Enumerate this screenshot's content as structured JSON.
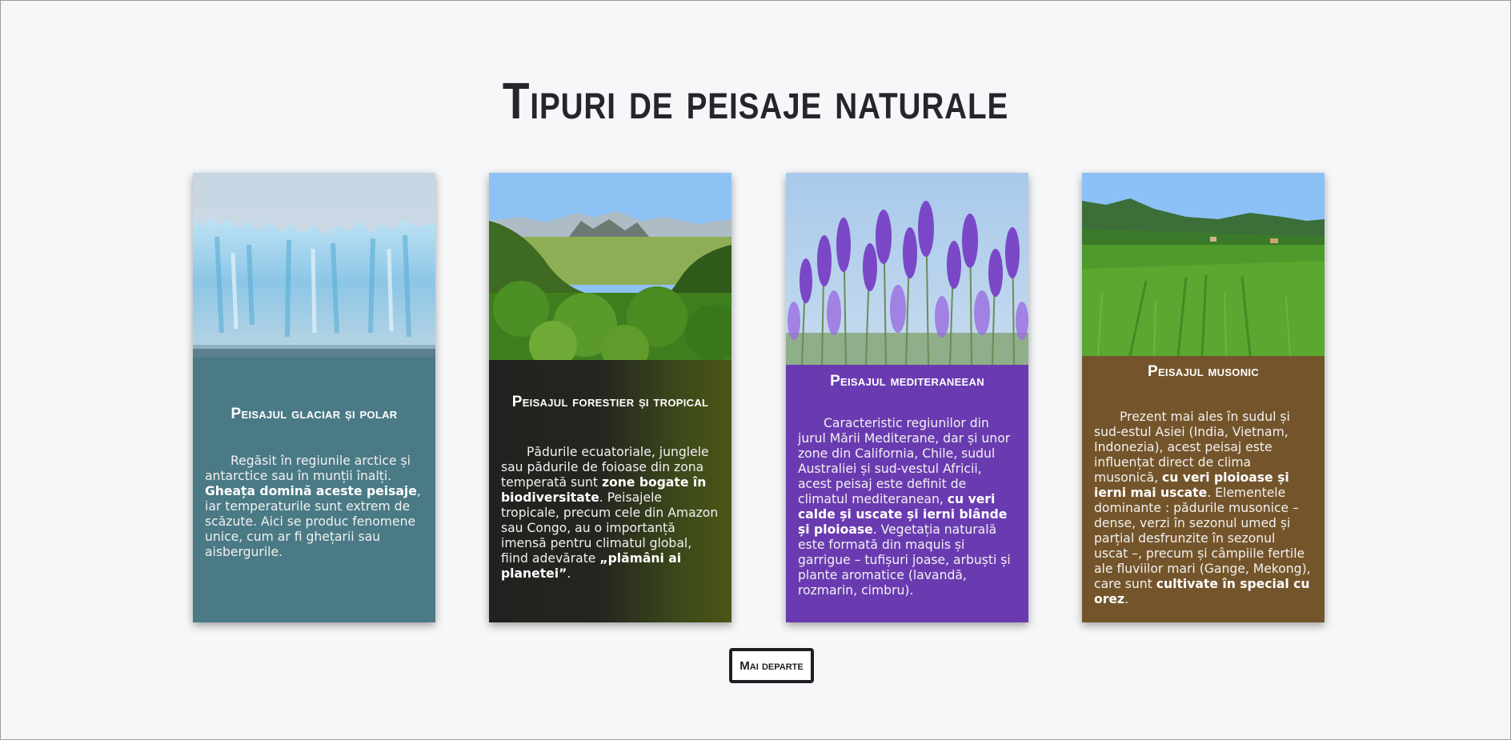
{
  "page": {
    "title": "Tipuri de peisaje naturale"
  },
  "cards": [
    {
      "image_name": "glacier-image",
      "title": "Peisajul glaciar și polar",
      "bg_color": "#4a7a85",
      "text": [
        {
          "t": "Regăsit în regiunile arctice și antarctice sau în munții înalți. "
        },
        {
          "t": "Gheața domină aceste peisaje",
          "b": true
        },
        {
          "t": ", iar temperaturile sunt extrem de scăzute. Aici se produc fenomene unice, cum ar fi ghețarii sau aisbergurile."
        }
      ]
    },
    {
      "image_name": "tropical-forest-image",
      "title": "Peisajul forestier și tropical",
      "bg_color": "#2a2c26",
      "text": [
        {
          "t": "Pădurile ecuatoriale, junglele sau pădurile de foioase din zona temperată sunt "
        },
        {
          "t": "zone bogate în biodiversitate",
          "b": true
        },
        {
          "t": ". Peisajele tropicale, precum cele din Amazon sau Congo, au o importanță imensă pentru climatul global, fiind adevărate "
        },
        {
          "t": "„plămâni ai planetei”",
          "b": true
        },
        {
          "t": "."
        }
      ]
    },
    {
      "image_name": "lavender-image",
      "title": "Peisajul mediteraneean",
      "bg_color": "#6a3bb0",
      "text": [
        {
          "t": "Caracteristic regiunilor din jurul Mării Mediterane, dar și unor zone din California, Chile, sudul Australiei și sud-vestul Africii, acest peisaj este definit de climatul mediteranean, "
        },
        {
          "t": "cu veri calde și uscate și ierni blânde și ploioase",
          "b": true
        },
        {
          "t": ". Vegetația naturală este formată din maquis și garrigue – tufișuri joase, arbuști și plante aromatice (lavandă, rozmarin, cimbru)."
        }
      ]
    },
    {
      "image_name": "rice-field-image",
      "title": "Peisajul musonic",
      "bg_color": "#74552b",
      "text": [
        {
          "t": "Prezent mai ales în sudul și sud-estul Asiei (India, Vietnam, Indonezia), acest peisaj este influențat direct de clima musonică, "
        },
        {
          "t": "cu veri ploioase și ierni mai uscate",
          "b": true
        },
        {
          "t": ". Elementele dominante : pădurile musonice – dense, verzi în sezonul umed și parțial desfrunzite în sezonul uscat –, precum și câmpiile fertile ale fluviilor mari (Gange, Mekong), care sunt "
        },
        {
          "t": "cultivate în special cu orez",
          "b": true
        },
        {
          "t": "."
        }
      ]
    }
  ],
  "more_button": {
    "label": "Mai departe"
  }
}
